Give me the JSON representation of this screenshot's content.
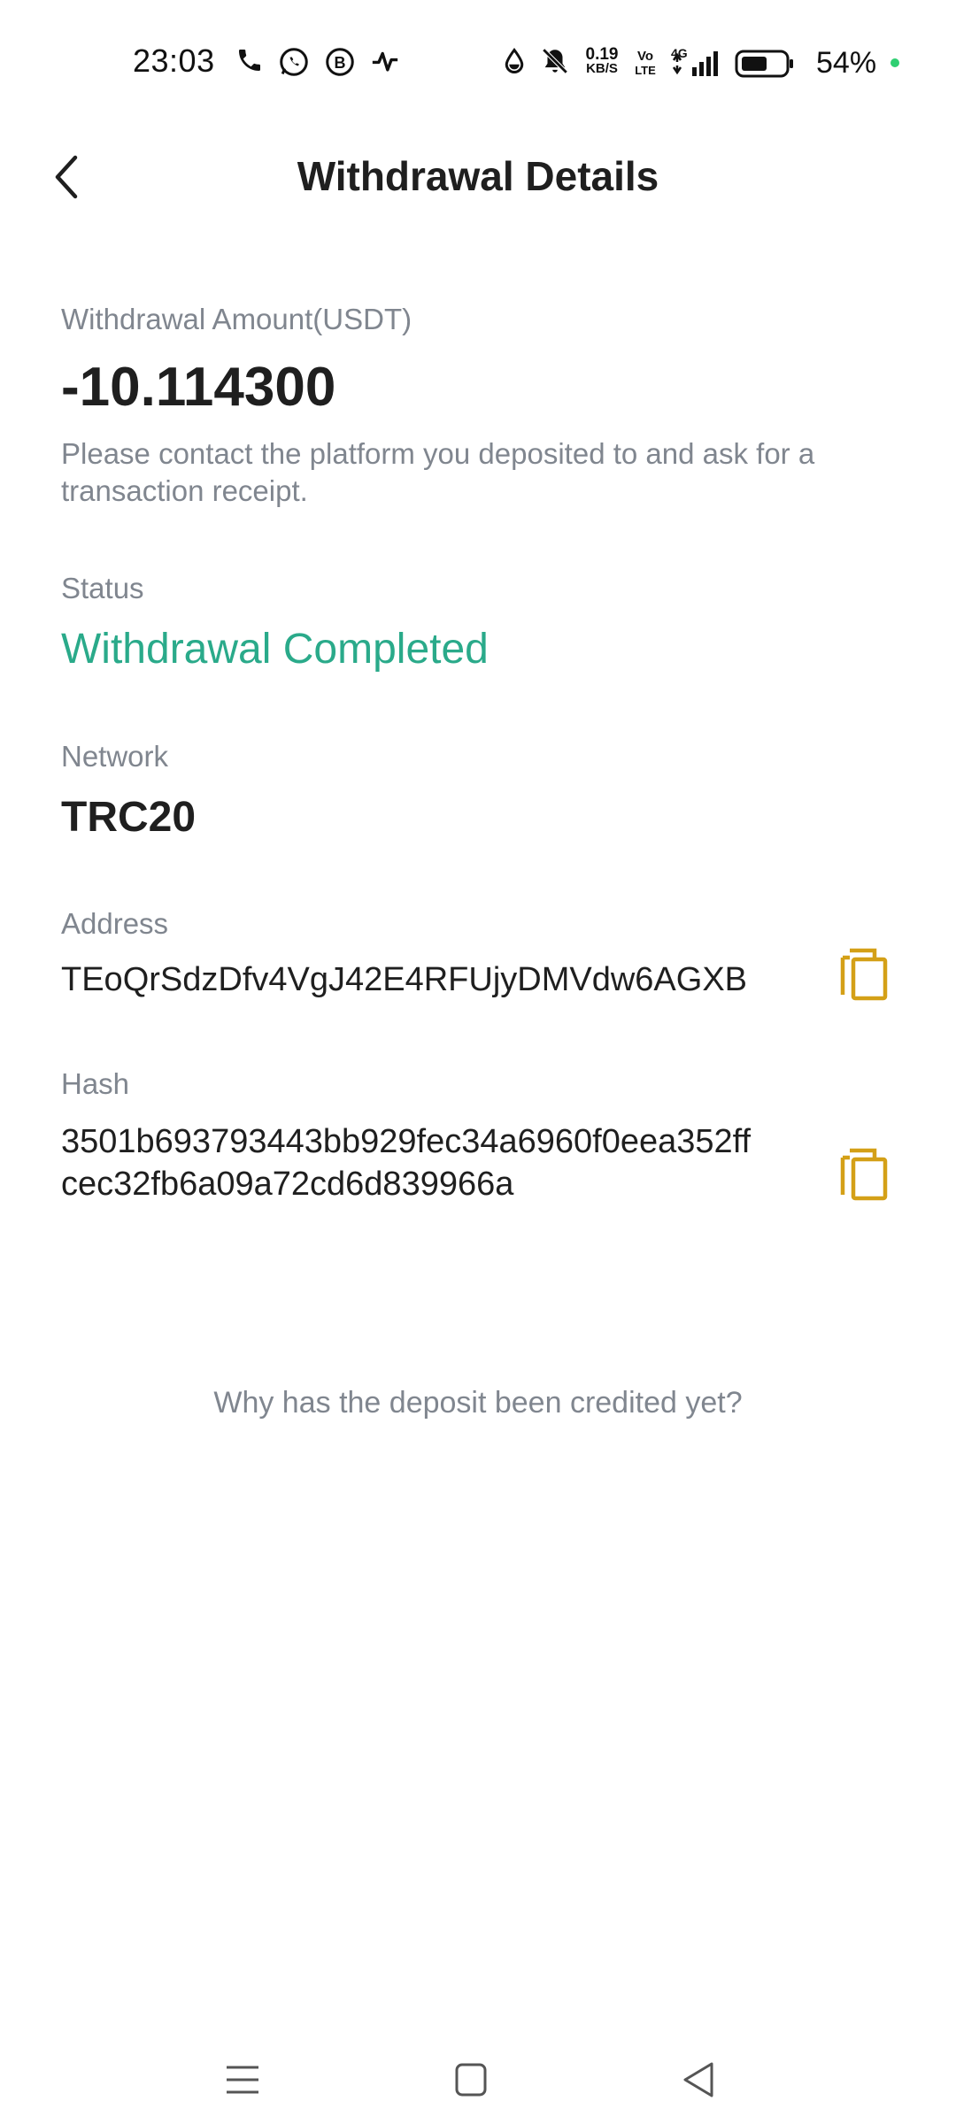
{
  "status_bar": {
    "time": "23:03",
    "net_speed_value": "0.19",
    "net_speed_unit": "KB/S",
    "volte_top": "Vo",
    "volte_bottom": "LTE",
    "network_type": "4G",
    "battery_percent": "54%",
    "icons": [
      "phone-icon",
      "whatsapp-icon",
      "whatsapp-business-icon",
      "activity-icon",
      "water-drop-icon",
      "bell-muted-icon",
      "signal-icon",
      "battery-icon"
    ]
  },
  "header": {
    "title": "Withdrawal Details",
    "back_icon": "chevron-left-icon"
  },
  "details": {
    "amount_label": "Withdrawal Amount(USDT)",
    "amount_value": "-10.114300",
    "note": "Please contact the platform you deposited to and ask for a transaction receipt.",
    "status_label": "Status",
    "status_value": "Withdrawal Completed",
    "network_label": "Network",
    "network_value": "TRC20",
    "address_label": "Address",
    "address_value": "TEoQrSdzDfv4VgJ42E4RFUjyDMVdw6AGXB",
    "hash_label": "Hash",
    "hash_line1": "3501b693793443bb929fec34a6960f0eea352ff",
    "hash_line2": "cec32fb6a09a72cd6d839966a"
  },
  "help_link": "Why has the deposit been credited yet?",
  "colors": {
    "status_green": "#2aaa8a",
    "copy_icon": "#d4a017",
    "muted_text": "#80868f"
  },
  "nav": {
    "icons": [
      "menu-icon",
      "home-square-icon",
      "back-triangle-icon"
    ]
  }
}
